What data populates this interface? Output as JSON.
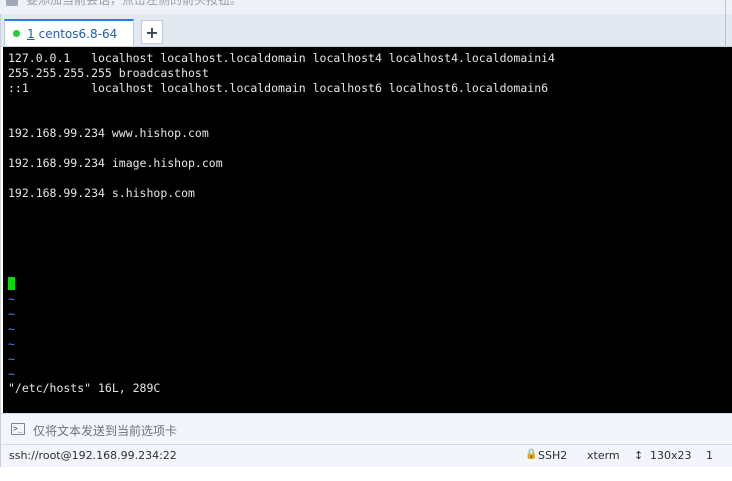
{
  "top_hint": {
    "text": "要添加当前会话，点击左侧的箭头按钮。"
  },
  "tabs": [
    {
      "number": "1",
      "label": "centos6.8-64",
      "active": true,
      "status_color": "#27c93f"
    }
  ],
  "add_tab_label": "+",
  "terminal": {
    "lines": [
      "127.0.0.1   localhost localhost.localdomain localhost4 localhost4.localdomaini4",
      "255.255.255.255 broadcasthost",
      "::1         localhost localhost.localdomain localhost6 localhost6.localdomain6",
      "192.168.99.234 www.hishop.com",
      "192.168.99.234 image.hishop.com",
      "192.168.99.234 s.hishop.com"
    ],
    "tilde": "~",
    "status_line": "\"/etc/hosts\" 16L, 289C",
    "cursor_color": "#00e000"
  },
  "send_bar": {
    "icon": "terminal-icon",
    "icon_glyph": ">_",
    "placeholder": "仅将文本发送到当前选项卡"
  },
  "status_bar": {
    "connection": "ssh://root@192.168.99.234:22",
    "lock_glyph": "🔒",
    "protocol": "SSH2",
    "terminal_type": "xterm",
    "size_glyph": "↕",
    "size": "130x23",
    "extra": "1"
  },
  "colors": {
    "accent": "#2d7be5",
    "tab_text": "#1b5fb8",
    "terminal_bg": "#000000",
    "tilde": "#4d86ff"
  }
}
